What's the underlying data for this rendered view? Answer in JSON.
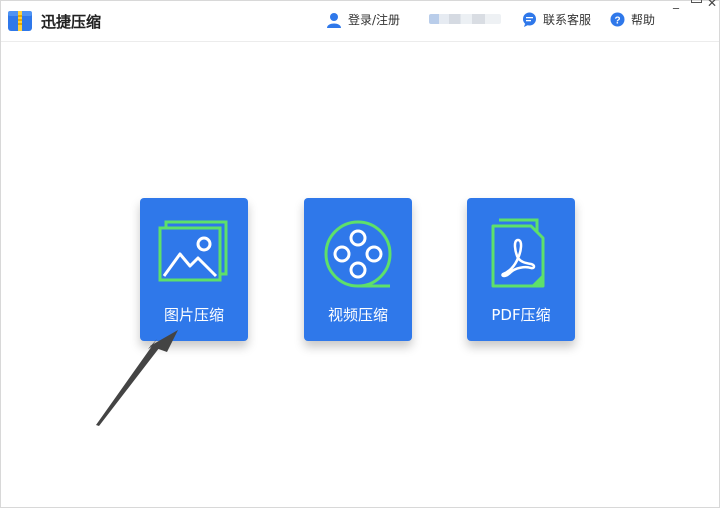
{
  "app": {
    "title": "迅捷压缩"
  },
  "header": {
    "login_label": "登录/注册",
    "service_label": "联系客服",
    "help_label": "帮助"
  },
  "tiles": [
    {
      "label": "图片压缩",
      "icon": "image-icon"
    },
    {
      "label": "视频压缩",
      "icon": "film-reel-icon"
    },
    {
      "label": "PDF压缩",
      "icon": "pdf-icon"
    }
  ],
  "colors": {
    "tile_bg": "#2f78ea",
    "icon_green": "#5ee06a",
    "header_icon_blue": "#2f78ea"
  }
}
